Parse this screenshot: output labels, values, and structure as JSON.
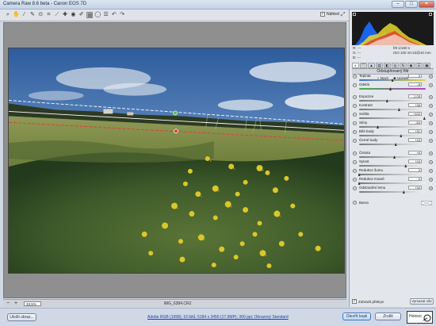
{
  "window": {
    "title": "Camera Raw 8.6 beta  -  Canon EOS 7D",
    "min": "–",
    "max": "□",
    "close": "✕"
  },
  "toolbar": {
    "tools": [
      {
        "name": "zoom-tool-icon",
        "glyph": "⌕"
      },
      {
        "name": "hand-tool-icon",
        "glyph": "✋"
      },
      {
        "name": "white-balance-tool-icon",
        "glyph": "⁄"
      },
      {
        "name": "color-sampler-tool-icon",
        "glyph": "✎"
      },
      {
        "name": "targeted-adjustment-tool-icon",
        "glyph": "⊙"
      },
      {
        "name": "crop-tool-icon",
        "glyph": "⌗"
      },
      {
        "name": "straighten-tool-icon",
        "glyph": "⟋"
      },
      {
        "name": "spot-removal-tool-icon",
        "glyph": "✚"
      },
      {
        "name": "red-eye-tool-icon",
        "glyph": "◉"
      },
      {
        "name": "adjustment-brush-icon",
        "glyph": "✐"
      },
      {
        "name": "graduated-filter-icon",
        "glyph": "▦"
      },
      {
        "name": "radial-filter-icon",
        "glyph": "◯"
      },
      {
        "name": "preferences-icon",
        "glyph": "☰"
      },
      {
        "name": "rotate-left-icon",
        "glyph": "↶"
      },
      {
        "name": "rotate-right-icon",
        "glyph": "↷"
      }
    ],
    "preview_label": "Náhled",
    "preview_checked": true
  },
  "status": {
    "zoom": "33,5%",
    "filename": "IMG_6384.CR2"
  },
  "panel": {
    "readout": {
      "r": "R:  ---",
      "g": "G:  ---",
      "b": "B:  ---",
      "aperture": "f/8    1/160 s",
      "iso": "ISO 100    10-22@10 mm"
    },
    "section_title": "Odstupňovaný filtr",
    "mode_new": "Nový",
    "mode_edit": "Upravit",
    "sliders": [
      {
        "label": "Teplota",
        "value": "0",
        "pos": 0.5
      },
      {
        "label": "Odstín",
        "value": "-8",
        "pos": 0.47
      },
      {
        "label": "Expozice",
        "value": "-1,05",
        "pos": 0.42
      },
      {
        "label": "Kontrast",
        "value": "+38",
        "pos": 0.6
      },
      {
        "label": "Světla",
        "value": "+100",
        "pos": 0.98
      },
      {
        "label": "Stíny",
        "value": "-54",
        "pos": 0.28
      },
      {
        "label": "Bílé body",
        "value": "+31",
        "pos": 0.63
      },
      {
        "label": "Černé body",
        "value": "+16",
        "pos": 0.55
      },
      {
        "label": "Čistota",
        "value": "+6",
        "pos": 0.53
      },
      {
        "label": "Sytost",
        "value": "+44",
        "pos": 0.7
      },
      {
        "label": "Redukce šumu",
        "value": "0",
        "pos": 0.0
      },
      {
        "label": "Redukce moaré",
        "value": "0",
        "pos": 0.0
      },
      {
        "label": "Odstranění lemu",
        "value": "+34",
        "pos": 0.67
      }
    ],
    "tone_label": "Barva",
    "overlay_label": "Zobrazit překryv",
    "overlay_checked": true,
    "clear_label": "Vymazat vše"
  },
  "bottom": {
    "save_label": "Uložit obraz...",
    "workflow_link": "Adobe RGB (1998); 16 bitů; 5184 x 3456 (17,9MP); 300 ppi; Obrazový Standard",
    "open_label": "Otevřít kopii",
    "cancel_label": "Zrušit",
    "done_label": "Hotovo"
  }
}
